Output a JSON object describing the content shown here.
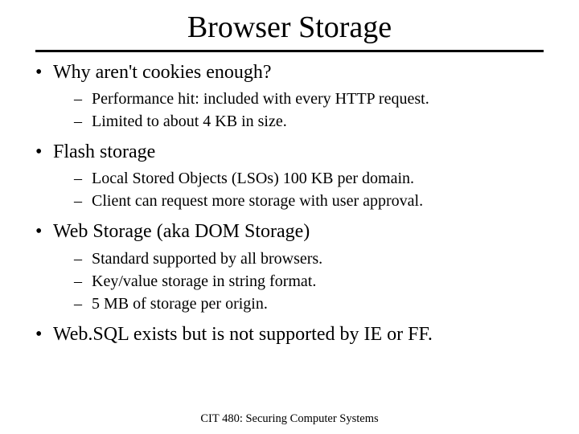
{
  "title": "Browser Storage",
  "bullets": [
    {
      "text": "Why aren't cookies enough?",
      "sub": [
        "Performance hit: included with every HTTP request.",
        "Limited to about 4 KB in size."
      ]
    },
    {
      "text": "Flash storage",
      "sub": [
        "Local Stored Objects (LSOs) 100 KB per domain.",
        "Client can request more storage with user approval."
      ]
    },
    {
      "text": "Web Storage (aka DOM Storage)",
      "sub": [
        "Standard supported by all browsers.",
        "Key/value storage in string format.",
        "5 MB of storage per origin."
      ]
    },
    {
      "text": "Web.SQL exists but is not supported by IE or FF.",
      "sub": []
    }
  ],
  "footer": "CIT 480: Securing Computer Systems"
}
